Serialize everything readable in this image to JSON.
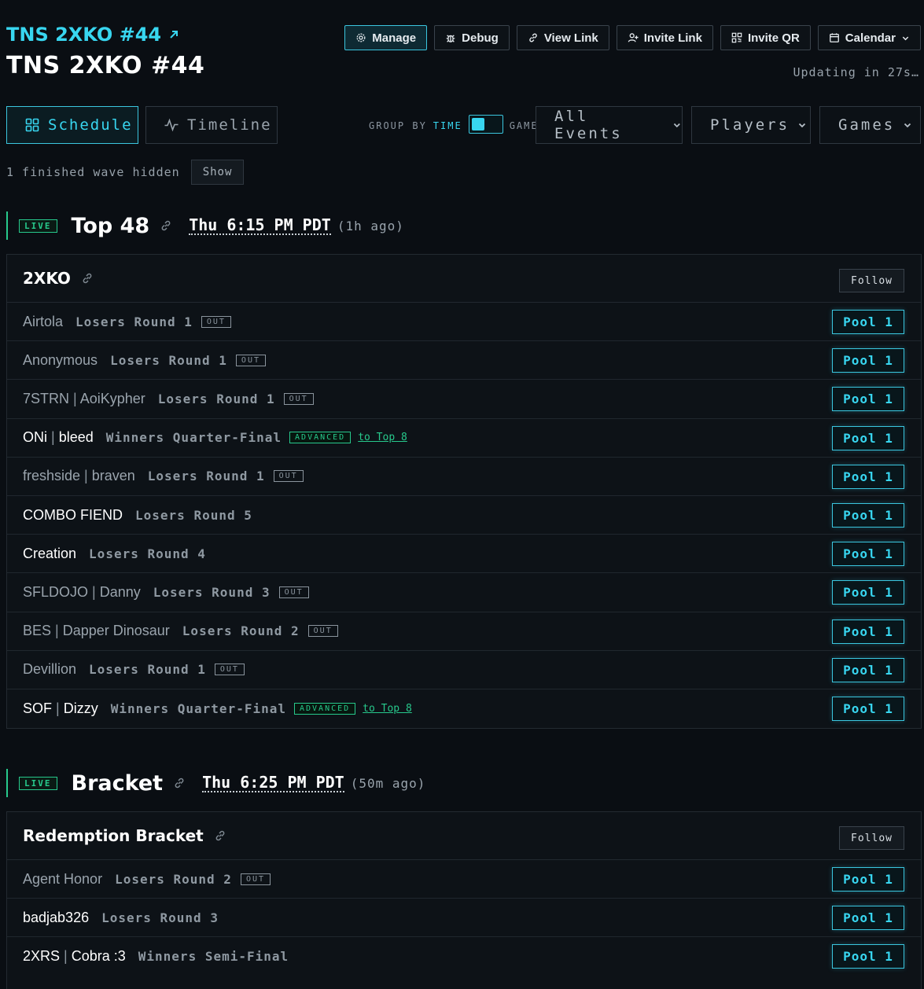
{
  "header": {
    "event_link": "TNS 2XKO #44",
    "title": "TNS 2XKO #44",
    "update_text": "Updating in 27s…",
    "buttons": {
      "manage": "Manage",
      "debug": "Debug",
      "view_link": "View Link",
      "invite_link": "Invite Link",
      "invite_qr": "Invite QR",
      "calendar": "Calendar"
    }
  },
  "tabs": {
    "schedule": "Schedule",
    "timeline": "Timeline"
  },
  "group_by": {
    "label": "GROUP BY",
    "option_time": "TIME",
    "option_game": "GAME"
  },
  "filters": {
    "events": "All Events",
    "players": "Players",
    "games": "Games"
  },
  "hidden": {
    "text": "1 finished wave hidden",
    "show": "Show"
  },
  "colors": {
    "accent": "#38d6f0",
    "live": "#27c98c",
    "background": "#0a0e13"
  },
  "sections": [
    {
      "live": "LIVE",
      "title": "Top 48",
      "time": "Thu 6:15 PM PDT",
      "ago": "(1h ago)",
      "panel": {
        "title": "2XKO",
        "follow": "Follow",
        "rows": [
          {
            "prefix": "",
            "name": "Airtola",
            "round": "Losers Round 1",
            "tag": "OUT",
            "pool": "Pool 1"
          },
          {
            "prefix": "",
            "name": "Anonymous",
            "round": "Losers Round 1",
            "tag": "OUT",
            "pool": "Pool 1"
          },
          {
            "prefix": "7STRN",
            "name": "AoiKypher",
            "round": "Losers Round 1",
            "tag": "OUT",
            "pool": "Pool 1"
          },
          {
            "prefix": "ONi",
            "name": "bleed",
            "round": "Winners Quarter-Final",
            "tag": "ADVANCED",
            "link": "to Top 8",
            "pool": "Pool 1"
          },
          {
            "prefix": "freshside",
            "name": "braven",
            "round": "Losers Round 1",
            "tag": "OUT",
            "pool": "Pool 1"
          },
          {
            "prefix": "",
            "name": "COMBO FIEND",
            "round": "Losers Round 5",
            "tag": "",
            "pool": "Pool 1"
          },
          {
            "prefix": "",
            "name": "Creation",
            "round": "Losers Round 4",
            "tag": "",
            "pool": "Pool 1"
          },
          {
            "prefix": "SFLDOJO",
            "name": "Danny",
            "round": "Losers Round 3",
            "tag": "OUT",
            "pool": "Pool 1"
          },
          {
            "prefix": "BES",
            "name": "Dapper Dinosaur",
            "round": "Losers Round 2",
            "tag": "OUT",
            "pool": "Pool 1"
          },
          {
            "prefix": "",
            "name": "Devillion",
            "round": "Losers Round 1",
            "tag": "OUT",
            "pool": "Pool 1"
          },
          {
            "prefix": "SOF",
            "name": "Dizzy",
            "round": "Winners Quarter-Final",
            "tag": "ADVANCED",
            "link": "to Top 8",
            "pool": "Pool 1"
          }
        ]
      }
    },
    {
      "live": "LIVE",
      "title": "Bracket",
      "time": "Thu 6:25 PM PDT",
      "ago": "(50m ago)",
      "panel": {
        "title": "Redemption Bracket",
        "follow": "Follow",
        "rows": [
          {
            "prefix": "",
            "name": "Agent Honor",
            "round": "Losers Round 2",
            "tag": "OUT",
            "pool": "Pool 1"
          },
          {
            "prefix": "",
            "name": "badjab326",
            "round": "Losers Round 3",
            "tag": "",
            "pool": "Pool 1"
          },
          {
            "prefix": "2XRS",
            "name": "Cobra :3",
            "round": "Winners Semi-Final",
            "tag": "",
            "pool": "Pool 1"
          }
        ]
      }
    }
  ]
}
